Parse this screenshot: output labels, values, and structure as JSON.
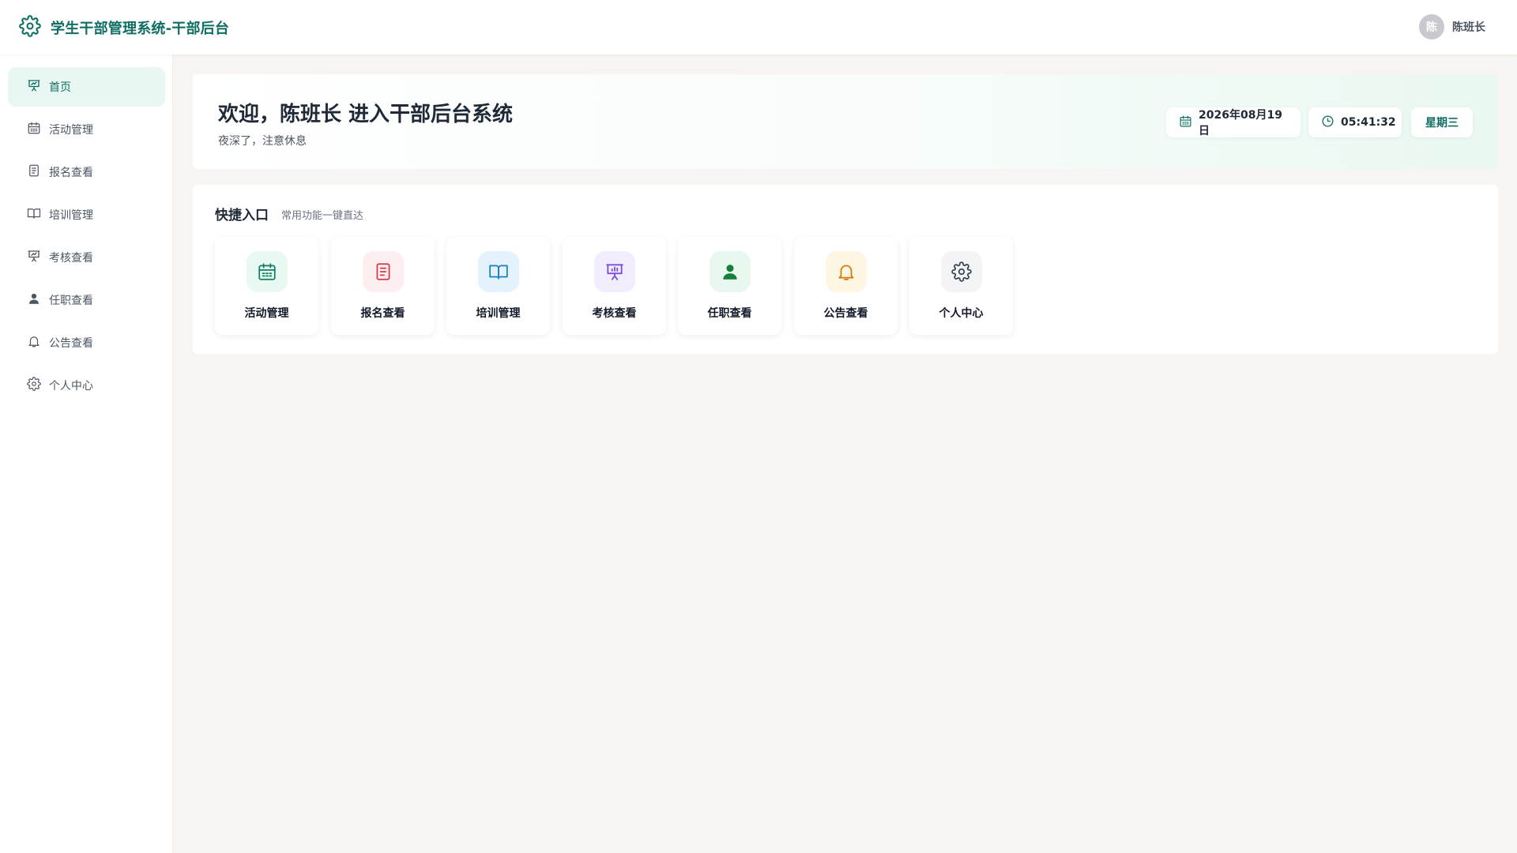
{
  "header": {
    "app_title": "学生干部管理系统-干部后台",
    "avatar_initial": "陈",
    "user_name": "陈班长",
    "logo_icon": "gear-icon",
    "brand_color": "#0f6e64"
  },
  "sidebar": {
    "active_index": 0,
    "items": [
      {
        "label": "首页",
        "icon": "presentation-icon"
      },
      {
        "label": "活动管理",
        "icon": "calendar-icon"
      },
      {
        "label": "报名查看",
        "icon": "document-icon"
      },
      {
        "label": "培训管理",
        "icon": "book-icon"
      },
      {
        "label": "考核查看",
        "icon": "presentation-icon"
      },
      {
        "label": "任职查看",
        "icon": "user-icon"
      },
      {
        "label": "公告查看",
        "icon": "bell-icon"
      },
      {
        "label": "个人中心",
        "icon": "gear-icon"
      }
    ]
  },
  "welcome": {
    "title": "欢迎，陈班长 进入干部后台系统",
    "subtitle": "夜深了，注意休息",
    "date": "2026年08月19日",
    "time": "05:41:32",
    "weekday": "星期三"
  },
  "quick": {
    "title": "快捷入口",
    "subtitle": "常用功能一键直达",
    "cards": [
      {
        "label": "活动管理",
        "icon": "calendar-icon",
        "color": "#0f7d62",
        "bg": "#e9f8f1"
      },
      {
        "label": "报名查看",
        "icon": "document-icon",
        "color": "#d9364a",
        "bg": "#fdeef0"
      },
      {
        "label": "培训管理",
        "icon": "book-icon",
        "color": "#1a7fc1",
        "bg": "#e3f2fc"
      },
      {
        "label": "考核查看",
        "icon": "presentation-icon",
        "color": "#7c4ddb",
        "bg": "#f2edfd"
      },
      {
        "label": "任职查看",
        "icon": "user-icon",
        "color": "#15803d",
        "bg": "#e9f8ef"
      },
      {
        "label": "公告查看",
        "icon": "bell-icon",
        "color": "#d97706",
        "bg": "#fdf6e3"
      },
      {
        "label": "个人中心",
        "icon": "gear-icon",
        "color": "#374151",
        "bg": "#f3f4f6"
      }
    ]
  }
}
